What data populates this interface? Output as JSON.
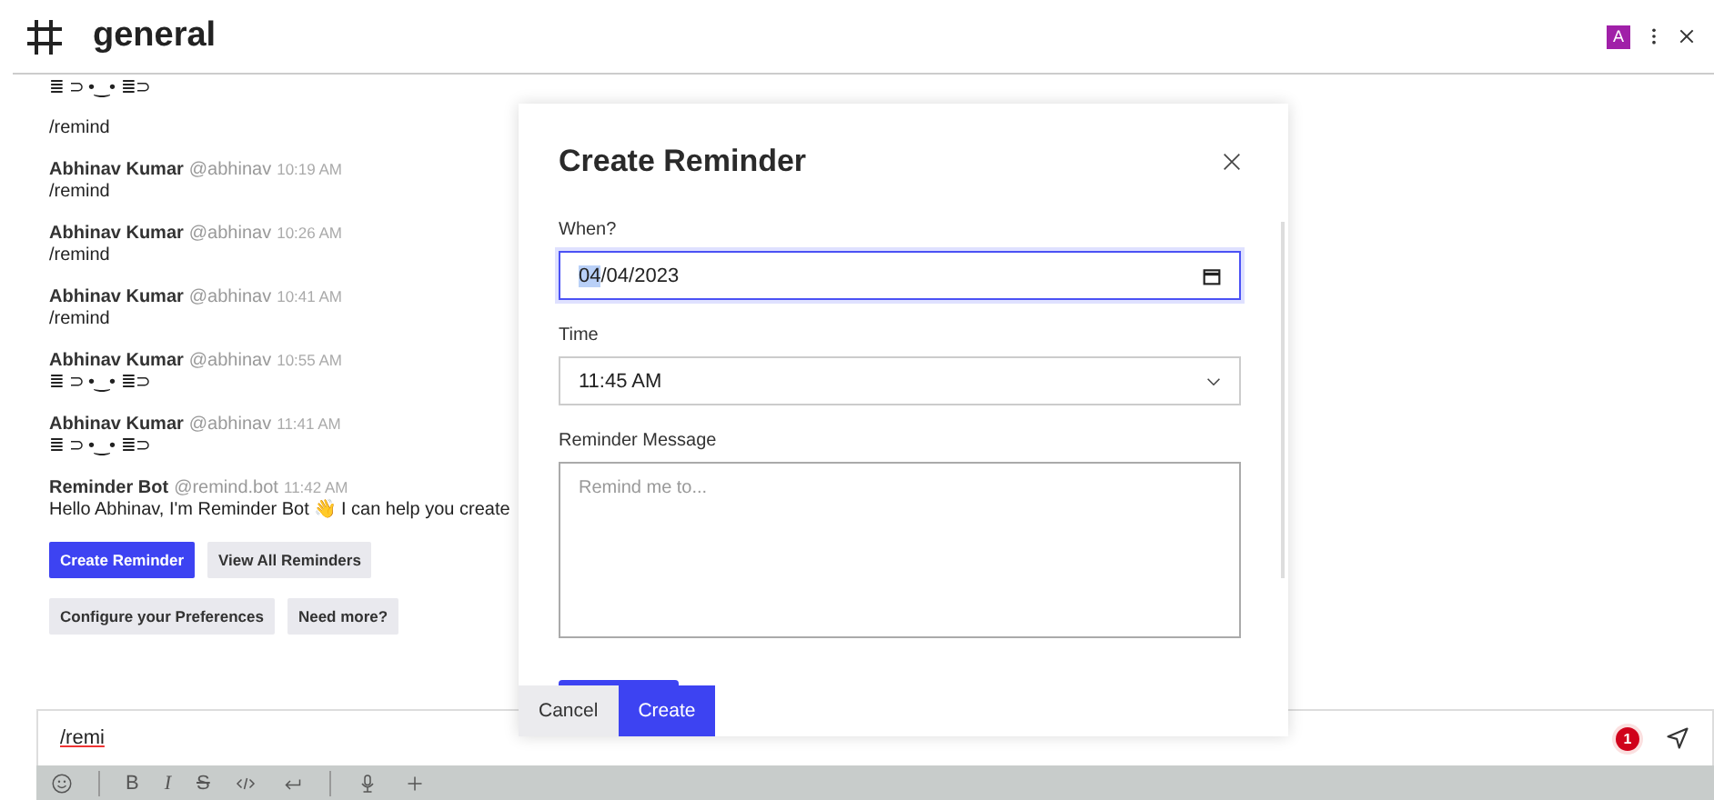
{
  "channel": {
    "name": "general",
    "avatar": "A"
  },
  "messages": [
    {
      "text": "≣ ⊃ •‿• ≣⊃"
    },
    {
      "text": "/remind"
    },
    {
      "author": "Abhinav Kumar",
      "handle": "@abhinav",
      "time": "10:19 AM",
      "text": "/remind"
    },
    {
      "author": "Abhinav Kumar",
      "handle": "@abhinav",
      "time": "10:26 AM",
      "text": "/remind"
    },
    {
      "author": "Abhinav Kumar",
      "handle": "@abhinav",
      "time": "10:41 AM",
      "text": "/remind"
    },
    {
      "author": "Abhinav Kumar",
      "handle": "@abhinav",
      "time": "10:55 AM",
      "text": "≣ ⊃ •‿• ≣⊃"
    },
    {
      "author": "Abhinav Kumar",
      "handle": "@abhinav",
      "time": "11:41 AM",
      "text": "≣ ⊃ •‿• ≣⊃"
    },
    {
      "author": "Reminder Bot",
      "handle": "@remind.bot",
      "time": "11:42 AM",
      "text": "Hello Abhinav, I'm Reminder Bot 👋 I can help you create"
    }
  ],
  "bot_buttons": [
    [
      {
        "label": "Create Reminder",
        "primary": true
      },
      {
        "label": "View All Reminders",
        "primary": false
      }
    ],
    [
      {
        "label": "Configure your Preferences",
        "primary": false
      },
      {
        "label": "Need more?",
        "primary": false
      }
    ]
  ],
  "modal": {
    "title": "Create Reminder",
    "when_label": "When?",
    "date_month": "04",
    "date_rest": "/04/2023",
    "time_label": "Time",
    "time_value": "11:45 AM",
    "message_label": "Reminder Message",
    "message_placeholder": "Remind me to...",
    "buttons": [
      {
        "label": "Cancel",
        "primary": false
      },
      {
        "label": "Create",
        "primary": true
      }
    ]
  },
  "composer": {
    "value": "/remi",
    "badge": "1",
    "format": [
      "B",
      "I",
      "S"
    ]
  }
}
